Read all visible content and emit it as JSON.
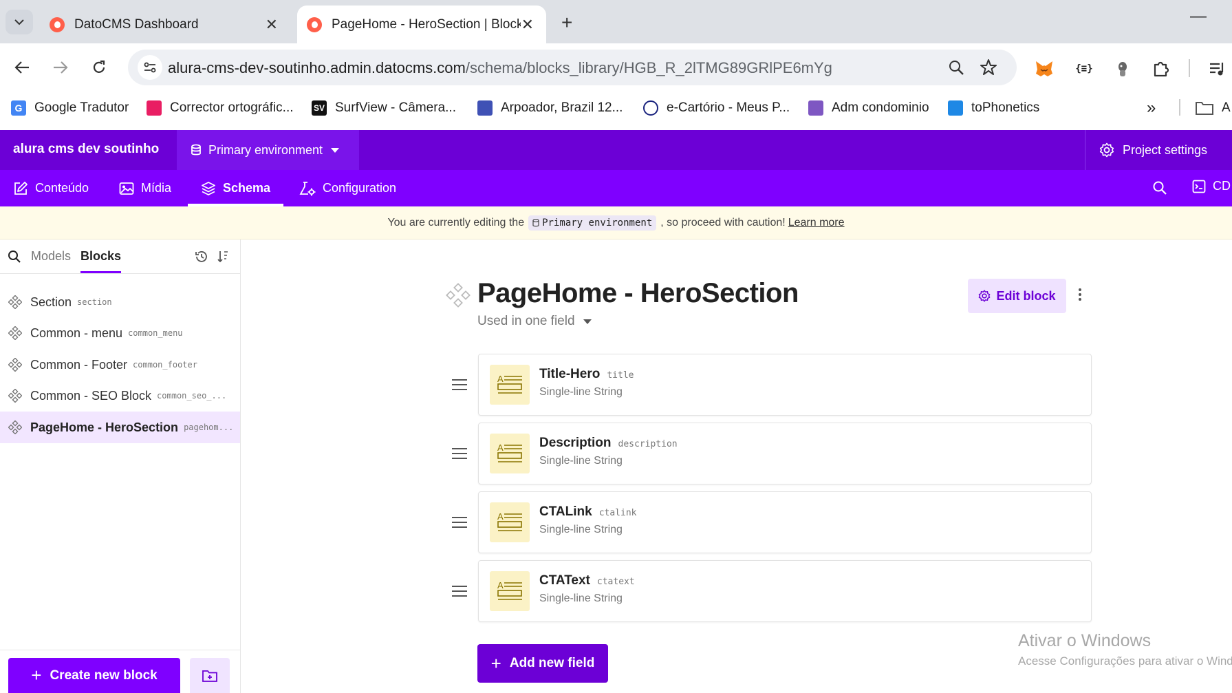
{
  "browser": {
    "tabs": [
      {
        "title": "DatoCMS Dashboard"
      },
      {
        "title": "PageHome - HeroSection | Blocks"
      }
    ],
    "close_glyph": "✕",
    "new_tab_glyph": "+",
    "minimize_glyph": "—",
    "url_host": "alura-cms-dev-soutinho.admin.datocms.com",
    "url_path": "/schema/blocks_library/HGB_R_2lTMG89GRlPE6mYg",
    "bookmarks": [
      {
        "label": "Google Tradutor",
        "color": "#4285f4"
      },
      {
        "label": "Corrector ortográfic...",
        "color": "#e91e63"
      },
      {
        "label": "SurfView - Câmera...",
        "color": "#111111"
      },
      {
        "label": "Arpoador, Brazil 12...",
        "color": "#3f51b5"
      },
      {
        "label": "e-Cartório - Meus P...",
        "color": "#1a237e"
      },
      {
        "label": "Adm condominio",
        "color": "#7e57c2"
      },
      {
        "label": "toPhonetics",
        "color": "#1e88e5"
      }
    ],
    "bookmarks_overflow": "»",
    "bookmarks_folder": "A"
  },
  "app": {
    "project_name": "alura cms dev soutinho",
    "environment": "Primary environment",
    "project_settings": "Project settings",
    "nav": [
      {
        "label": "Conteúdo"
      },
      {
        "label": "Mídia"
      },
      {
        "label": "Schema"
      },
      {
        "label": "Configuration"
      }
    ],
    "nav_right": "CD",
    "accent": "#7f00ff"
  },
  "banner": {
    "prefix": "You are currently editing the",
    "env": "Primary environment",
    "suffix": ", so proceed with caution!",
    "link": "Learn more"
  },
  "sidebar": {
    "tabs": [
      "Models",
      "Blocks"
    ],
    "items": [
      {
        "name": "Section",
        "api": "section"
      },
      {
        "name": "Common - menu",
        "api": "common_menu"
      },
      {
        "name": "Common - Footer",
        "api": "common_footer"
      },
      {
        "name": "Common - SEO Block",
        "api": "common_seo_..."
      },
      {
        "name": "PageHome - HeroSection",
        "api": "pagehom..."
      }
    ],
    "create_button": "Create new block"
  },
  "main": {
    "title": "PageHome - HeroSection",
    "used_in": "Used in one field",
    "edit_button": "Edit block",
    "fields": [
      {
        "name": "Title-Hero",
        "api": "title",
        "type": "Single-line String"
      },
      {
        "name": "Description",
        "api": "description",
        "type": "Single-line String"
      },
      {
        "name": "CTALink",
        "api": "ctalink",
        "type": "Single-line String"
      },
      {
        "name": "CTAText",
        "api": "ctatext",
        "type": "Single-line String"
      }
    ],
    "add_field_button": "Add new field"
  },
  "watermark": {
    "title": "Ativar o Windows",
    "subtitle": "Acesse Configurações para ativar o Windows."
  }
}
